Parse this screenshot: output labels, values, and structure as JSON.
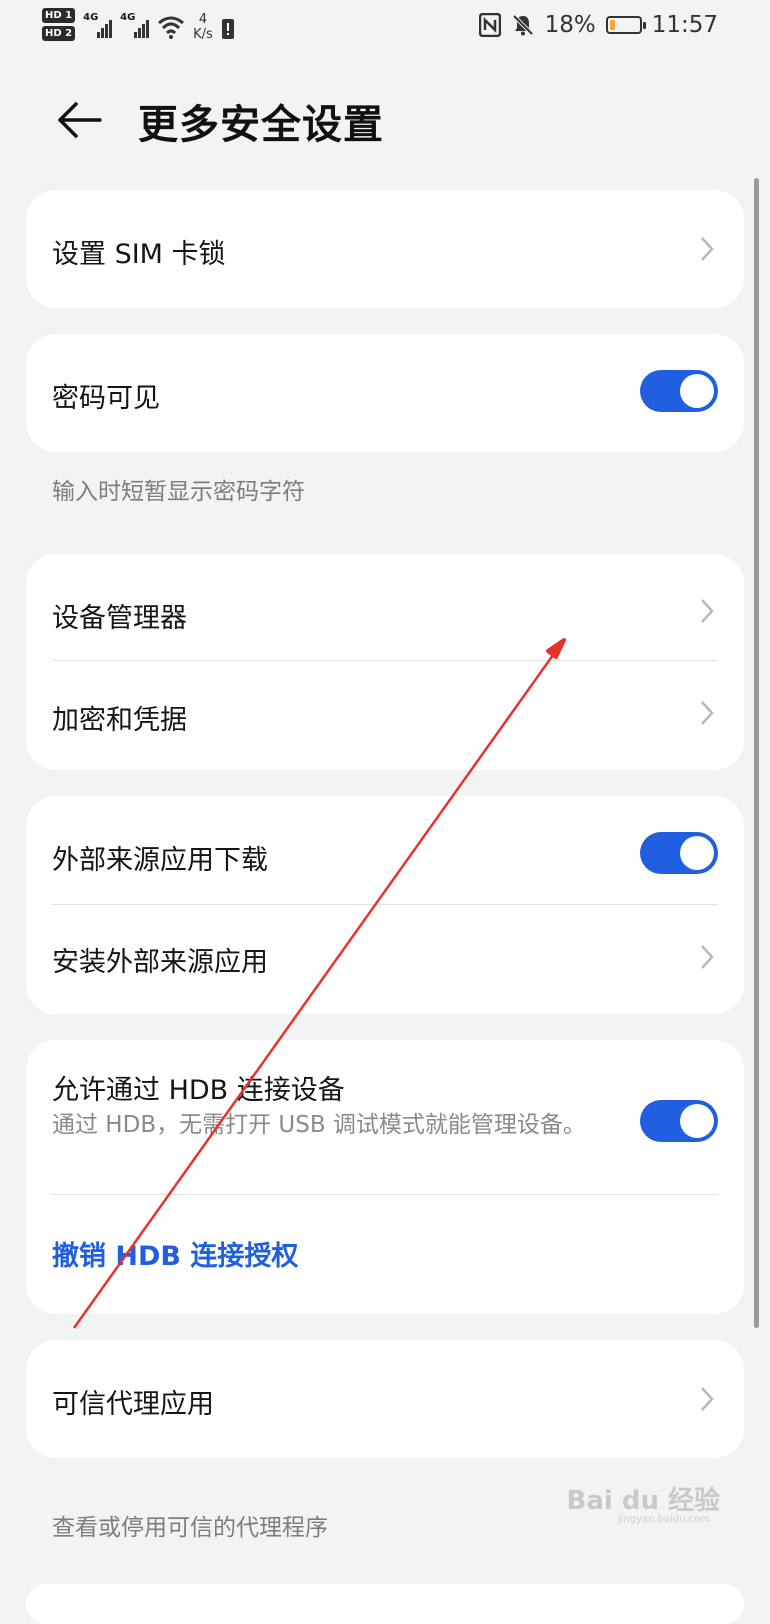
{
  "status_bar": {
    "sim1": "HD 1",
    "sim2": "HD 2",
    "net1": "4G",
    "net2": "4G",
    "speed_value": "4",
    "speed_unit": "K/s",
    "battery_percent": "18%",
    "battery_level": 0.18,
    "time": "11:57",
    "icons": [
      "nfc-icon",
      "mute-icon",
      "battery-icon",
      "wifi-icon",
      "signal-icon"
    ]
  },
  "header": {
    "title": "更多安全设置",
    "back_icon": "arrow-left-icon"
  },
  "sections": {
    "sim_lock": {
      "label": "设置 SIM 卡锁"
    },
    "password_visible": {
      "label": "密码可见",
      "enabled": true,
      "footnote": "输入时短暂显示密码字符"
    },
    "device_admin": {
      "label": "设备管理器"
    },
    "encryption": {
      "label": "加密和凭据"
    },
    "external_download": {
      "label": "外部来源应用下载",
      "enabled": true
    },
    "install_external": {
      "label": "安装外部来源应用"
    },
    "hdb": {
      "label": "允许通过 HDB 连接设备",
      "description": "通过 HDB，无需打开 USB 调试模式就能管理设备。",
      "enabled": true,
      "revoke_label": "撤销 HDB 连接授权"
    },
    "trust_agents": {
      "label": "可信代理应用",
      "footnote": "查看或停用可信的代理程序"
    }
  },
  "watermark": {
    "text": "Bai du 经验",
    "sub": "jingyan.baidu.com"
  },
  "colors": {
    "accent": "#1f5fe0",
    "annotation": "#e8322b",
    "background": "#f1f3f5"
  }
}
